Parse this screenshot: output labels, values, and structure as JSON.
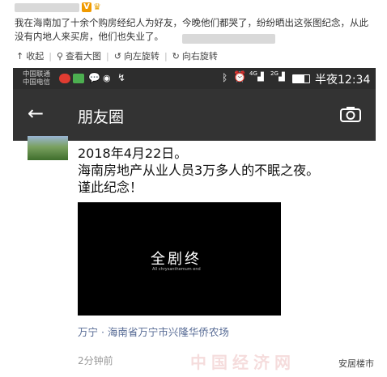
{
  "post": {
    "text": "我在海南加了十余个购房经纪人为好友，今晚他们都哭了，纷纷晒出这张图纪念，从此没有内地人来买房，他们也失业了。",
    "v_badge": "V"
  },
  "toolbar": {
    "collapse": "收起",
    "view_large": "查看大图",
    "rotate_left": "向左旋转",
    "rotate_right": "向右旋转"
  },
  "statusbar": {
    "carrier1": "中国联通",
    "carrier2": "中国电信",
    "signal1": "4G",
    "signal2": "2G",
    "time": "半夜12:34"
  },
  "navbar": {
    "title": "朋友圈"
  },
  "moment": {
    "line1": "2018年4月22日。",
    "line2": "海南房地产从业人员3万多人的不眠之夜。",
    "line3": "谨此纪念！",
    "video_title": "全剧终",
    "video_subtitle": "All chrysanthemum end",
    "location": "万宁 · 海南省万宁市兴隆华侨农场",
    "time_ago": "2分钟前"
  },
  "watermark": {
    "faded": "中国经济网",
    "source": "安居楼市"
  },
  "colors": {
    "statusbar": "#2d2d2d",
    "navbar": "#333333",
    "link": "#576b95",
    "badge": "#f09a00"
  }
}
